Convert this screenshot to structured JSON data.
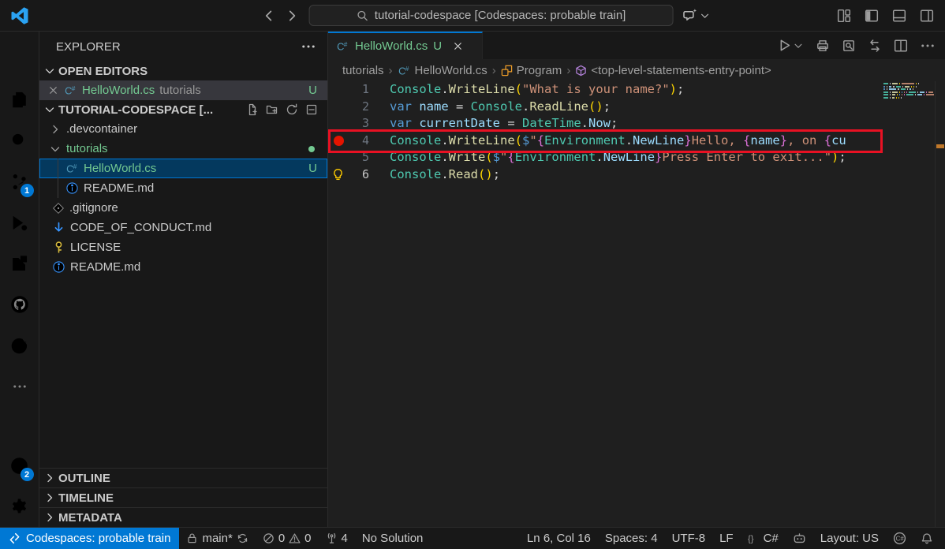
{
  "title_bar": {
    "search_value": "tutorial-codespace [Codespaces: probable train]"
  },
  "activity_bar": {
    "source_control_badge": "1",
    "accounts_badge": "2"
  },
  "sidebar": {
    "title": "EXPLORER",
    "open_editors": {
      "header": "OPEN EDITORS",
      "file": "HelloWorld.cs",
      "detail": "tutorials",
      "badge": "U"
    },
    "tree_header": "TUTORIAL-CODESPACE [...",
    "tree": [
      {
        "label": ".devcontainer",
        "kind": "folder",
        "chevron": "right"
      },
      {
        "label": "tutorials",
        "kind": "folder",
        "chevron": "down",
        "green": true,
        "dot": true
      },
      {
        "label": "HelloWorld.cs",
        "icon": "csharp",
        "indent": 1,
        "selected": true,
        "green": true,
        "badge": "U"
      },
      {
        "label": "README.md",
        "icon": "info",
        "indent": 1
      },
      {
        "label": ".gitignore",
        "icon": "git"
      },
      {
        "label": "CODE_OF_CONDUCT.md",
        "icon": "arrow-down"
      },
      {
        "label": "LICENSE",
        "icon": "key"
      },
      {
        "label": "README.md",
        "icon": "info"
      }
    ],
    "sections": [
      "OUTLINE",
      "TIMELINE",
      "METADATA"
    ]
  },
  "editor": {
    "tab": {
      "label": "HelloWorld.cs",
      "badge": "U"
    },
    "breadcrumbs": [
      {
        "label": "tutorials",
        "icon": null
      },
      {
        "label": "HelloWorld.cs",
        "icon": "csharp"
      },
      {
        "label": "Program",
        "icon": "symbol-class"
      },
      {
        "label": "<top-level-statements-entry-point>",
        "icon": "symbol-cube"
      }
    ],
    "breakpoint_line": 4,
    "lightbulb_line": 6,
    "highlight_line": 4,
    "active_line": 6,
    "code": [
      {
        "n": 1,
        "tokens": [
          [
            "Console",
            "cls"
          ],
          [
            ".",
            "pn"
          ],
          [
            "WriteLine",
            "fn"
          ],
          [
            "(",
            "b1"
          ],
          [
            "\"What is your name?\"",
            "str"
          ],
          [
            ")",
            "b1"
          ],
          [
            ";",
            "pn"
          ]
        ]
      },
      {
        "n": 2,
        "tokens": [
          [
            "var",
            "kw"
          ],
          [
            " ",
            "pn"
          ],
          [
            "name",
            "vr"
          ],
          [
            " = ",
            "pn"
          ],
          [
            "Console",
            "cls"
          ],
          [
            ".",
            "pn"
          ],
          [
            "ReadLine",
            "fn"
          ],
          [
            "(",
            "b1"
          ],
          [
            ")",
            "b1"
          ],
          [
            ";",
            "pn"
          ]
        ]
      },
      {
        "n": 3,
        "tokens": [
          [
            "var",
            "kw"
          ],
          [
            " ",
            "pn"
          ],
          [
            "currentDate",
            "vr"
          ],
          [
            " = ",
            "pn"
          ],
          [
            "DateTime",
            "cls"
          ],
          [
            ".",
            "pn"
          ],
          [
            "Now",
            "vr"
          ],
          [
            ";",
            "pn"
          ]
        ]
      },
      {
        "n": 4,
        "tokens": [
          [
            "Console",
            "cls"
          ],
          [
            ".",
            "pn"
          ],
          [
            "WriteLine",
            "fn"
          ],
          [
            "(",
            "b1"
          ],
          [
            "$",
            "kw"
          ],
          [
            "\"",
            "str"
          ],
          [
            "{",
            "b2"
          ],
          [
            "Environment",
            "cls"
          ],
          [
            ".",
            "pn"
          ],
          [
            "NewLine",
            "vr"
          ],
          [
            "}",
            "b2"
          ],
          [
            "Hello, ",
            "str"
          ],
          [
            "{",
            "b2"
          ],
          [
            "name",
            "vr"
          ],
          [
            "}",
            "b2"
          ],
          [
            ", on ",
            "str"
          ],
          [
            "{",
            "b2"
          ],
          [
            "cu",
            "vr"
          ]
        ]
      },
      {
        "n": 5,
        "tokens": [
          [
            "Console",
            "cls"
          ],
          [
            ".",
            "pn"
          ],
          [
            "Write",
            "fn"
          ],
          [
            "(",
            "b1"
          ],
          [
            "$",
            "kw"
          ],
          [
            "\"",
            "str"
          ],
          [
            "{",
            "b2"
          ],
          [
            "Environment",
            "cls"
          ],
          [
            ".",
            "pn"
          ],
          [
            "NewLine",
            "vr"
          ],
          [
            "}",
            "b2"
          ],
          [
            "Press Enter to exit...\"",
            "str"
          ],
          [
            ")",
            "b1"
          ],
          [
            ";",
            "pn"
          ]
        ]
      },
      {
        "n": 6,
        "tokens": [
          [
            "Console",
            "cls"
          ],
          [
            ".",
            "pn"
          ],
          [
            "Read",
            "fn"
          ],
          [
            "(",
            "b1"
          ],
          [
            ")",
            "b1"
          ],
          [
            ";",
            "pn"
          ]
        ]
      }
    ]
  },
  "status_bar": {
    "remote": "Codespaces: probable train",
    "branch": "main*",
    "errors": "0",
    "warnings": "0",
    "ports": "4",
    "solution": "No Solution",
    "cursor": "Ln 6, Col 16",
    "indentation": "Spaces: 4",
    "encoding": "UTF-8",
    "eol": "LF",
    "language": "C#",
    "layout": "Layout: US"
  }
}
